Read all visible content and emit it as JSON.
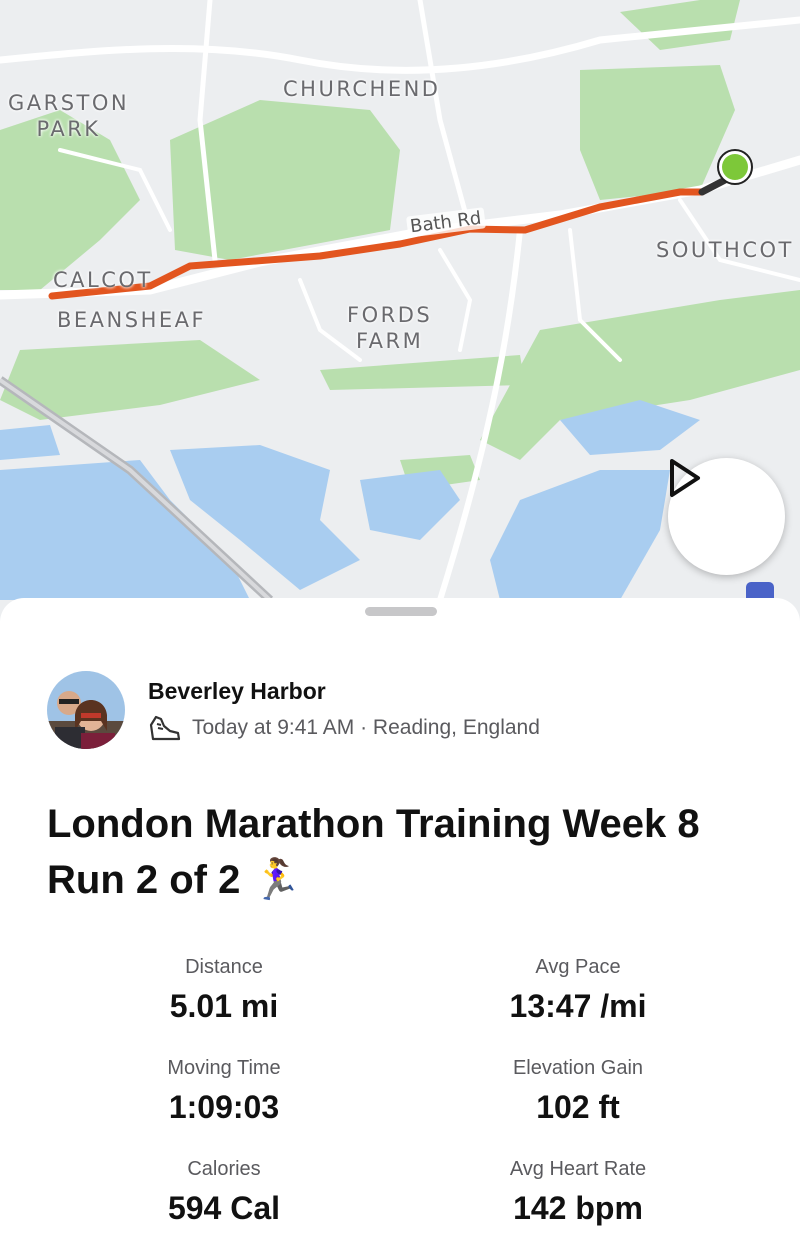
{
  "map": {
    "place_labels": [
      "GARSTON\nPARK",
      "CHURCHEND",
      "CALCOT",
      "BEANSHEAF",
      "FORDS\nFARM",
      "SOUTHCOT"
    ],
    "road_label": "Bath Rd",
    "colors": {
      "route": "#e2551f",
      "start": "#7dc839",
      "park": "#b9dfae",
      "water": "#a9cdf0",
      "land": "#eceef0"
    }
  },
  "icons": {
    "play": "play-icon",
    "activity": "run-shoe-icon",
    "map_control": "map-layers-icon"
  },
  "activity": {
    "athlete": "Beverley Harbor",
    "meta": "Today at 9:41 AM · Reading, England",
    "title": "London Marathon Training Week 8 Run 2 of 2 🏃‍♀️",
    "stats": [
      {
        "label": "Distance",
        "value": "5.01 mi"
      },
      {
        "label": "Avg Pace",
        "value": "13:47 /mi"
      },
      {
        "label": "Moving Time",
        "value": "1:09:03"
      },
      {
        "label": "Elevation Gain",
        "value": "102 ft"
      },
      {
        "label": "Calories",
        "value": "594 Cal"
      },
      {
        "label": "Avg Heart Rate",
        "value": "142 bpm"
      }
    ]
  }
}
